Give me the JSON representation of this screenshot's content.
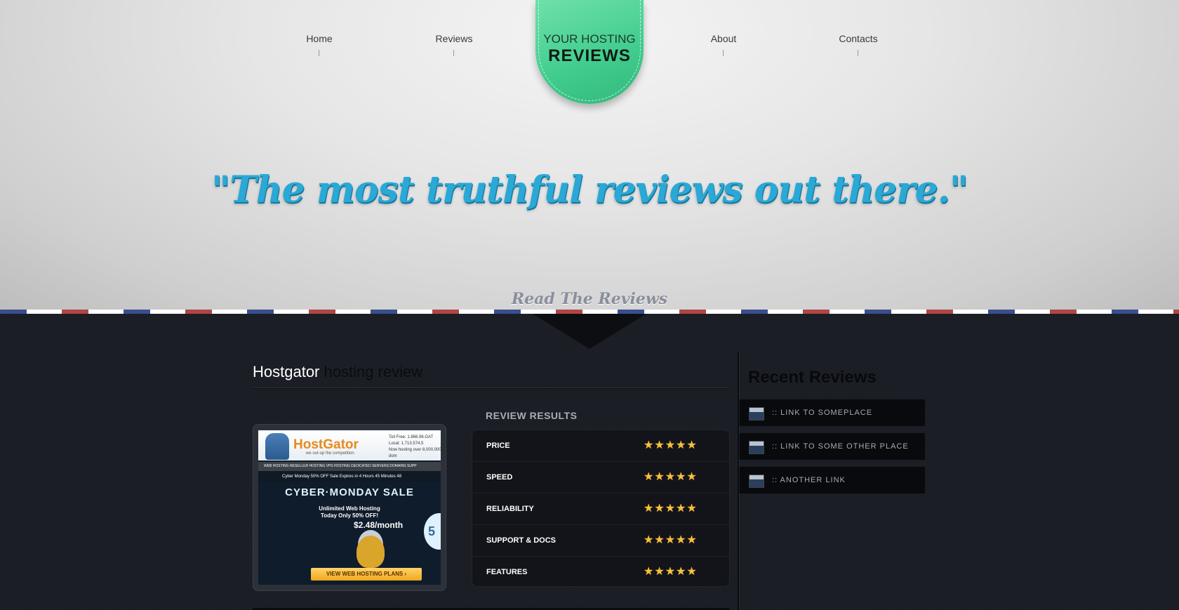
{
  "nav": {
    "items": [
      {
        "label": "Home"
      },
      {
        "label": "Reviews"
      },
      {
        "label": "About"
      },
      {
        "label": "Contacts"
      }
    ]
  },
  "logo": {
    "line1": "YOUR HOSTING",
    "line2": "REVIEWS"
  },
  "hero": {
    "tagline": "\"The most truthful reviews out there.\"",
    "read_link": "Read The Reviews"
  },
  "review": {
    "title_brand": "Hostgator",
    "title_rest": " hosting review",
    "results_heading": "REVIEW RESULTS",
    "rows": [
      {
        "label": "PRICE",
        "stars": "★★★★★"
      },
      {
        "label": "SPEED",
        "stars": "★★★★★"
      },
      {
        "label": "RELIABILITY",
        "stars": "★★★★★"
      },
      {
        "label": "SUPPORT & DOCS",
        "stars": "★★★★★"
      },
      {
        "label": "FEATURES",
        "stars": "★★★★★"
      }
    ],
    "screenshot": {
      "brand": "HostGator",
      "tag": "we out-up the competition",
      "toll": "Toll Free: 1.866.96.GAT",
      "local": "Local: 1.713.574.5",
      "hosting_over": "Now hosting over 8,000,000 dom",
      "nav": "WEB HOSTING   RESELLER HOSTING   VPS HOSTING   DEDICATED SERVERS   DOMAINS   SUPP",
      "strip": "Cyber Monday 50% OFF Sale Expires in 4 Hours 45 Minutes 48",
      "headline": "CYBER·MONDAY SALE",
      "uw1": "Unlimited Web Hosting",
      "uw2": "Today Only 50% OFF!",
      "price": "$2.48/month",
      "button": "VIEW WEB HOSTING PLANS ›"
    }
  },
  "sidebar": {
    "title": "Recent Reviews",
    "links": [
      {
        "label": ":: LINK TO SOMEPLACE"
      },
      {
        "label": ":: LINK TO SOME OTHER PLACE"
      },
      {
        "label": ":: ANOTHER LINK"
      }
    ]
  },
  "colors": {
    "accent": "#2aa8d6",
    "logo_green": "#3fcc8d",
    "stars": "#f5c040",
    "dark_bg": "#1a1d22"
  }
}
